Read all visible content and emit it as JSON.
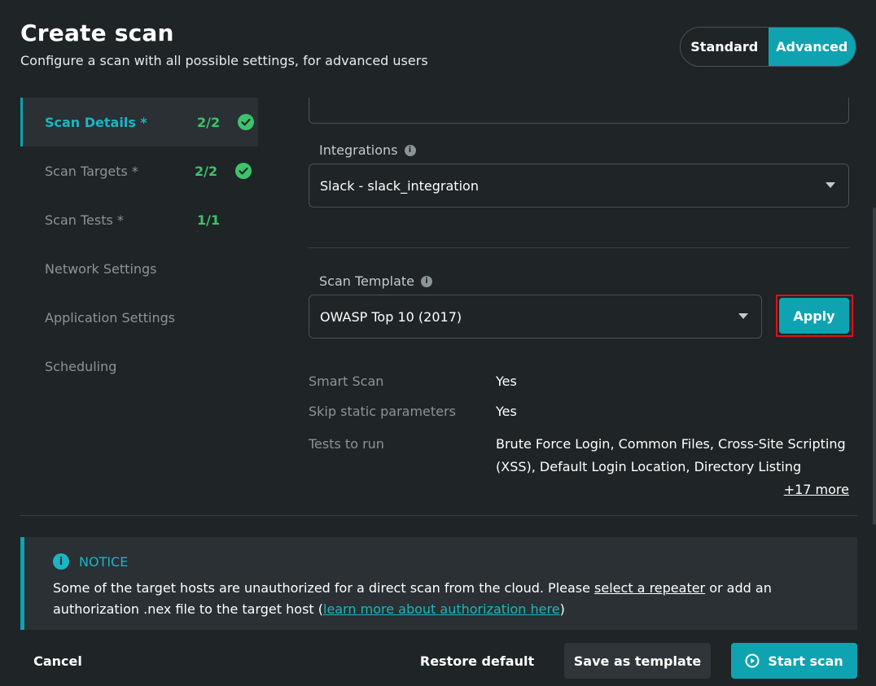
{
  "header": {
    "title": "Create scan",
    "subtitle": "Configure a scan with all possible settings, for advanced users"
  },
  "mode_toggle": {
    "standard": "Standard",
    "advanced": "Advanced",
    "selected": "Advanced"
  },
  "nav": {
    "items": [
      {
        "label": "Scan Details *",
        "count": "2/2",
        "complete": true,
        "active": true
      },
      {
        "label": "Scan Targets *",
        "count": "2/2",
        "complete": true,
        "active": false
      },
      {
        "label": "Scan Tests *",
        "count": "1/1",
        "complete": false,
        "active": false
      },
      {
        "label": "Network Settings",
        "count": "",
        "complete": false,
        "active": false
      },
      {
        "label": "Application Settings",
        "count": "",
        "complete": false,
        "active": false
      },
      {
        "label": "Scheduling",
        "count": "",
        "complete": false,
        "active": false
      }
    ]
  },
  "integrations": {
    "label": "Integrations",
    "value": "Slack - slack_integration"
  },
  "scan_template": {
    "label": "Scan Template",
    "value": "OWASP Top 10 (2017)",
    "apply_label": "Apply"
  },
  "template_summary": {
    "smart_scan_key": "Smart Scan",
    "smart_scan_value": "Yes",
    "skip_static_key": "Skip static parameters",
    "skip_static_value": "Yes",
    "tests_key": "Tests to run",
    "tests_line1": "Brute Force Login, Common Files, Cross-Site Scripting",
    "tests_line2": "(XSS), Default Login Location, Directory Listing",
    "more_link": "+17 more"
  },
  "notice": {
    "title": "NOTICE",
    "text_1": "Some of the target hosts are unauthorized for a direct scan from the cloud. Please ",
    "link_1": "select a repeater",
    "text_2": " or add an authorization .nex file to the target host (",
    "link_2": "learn more about authorization here",
    "text_3": ")"
  },
  "footer": {
    "cancel": "Cancel",
    "restore_default": "Restore default",
    "save_as_template": "Save as template",
    "start_scan": "Start scan"
  },
  "colors": {
    "accent": "#0fa3b1",
    "success": "#3cc46c",
    "highlight": "#e0101e",
    "background": "#1f2426"
  }
}
